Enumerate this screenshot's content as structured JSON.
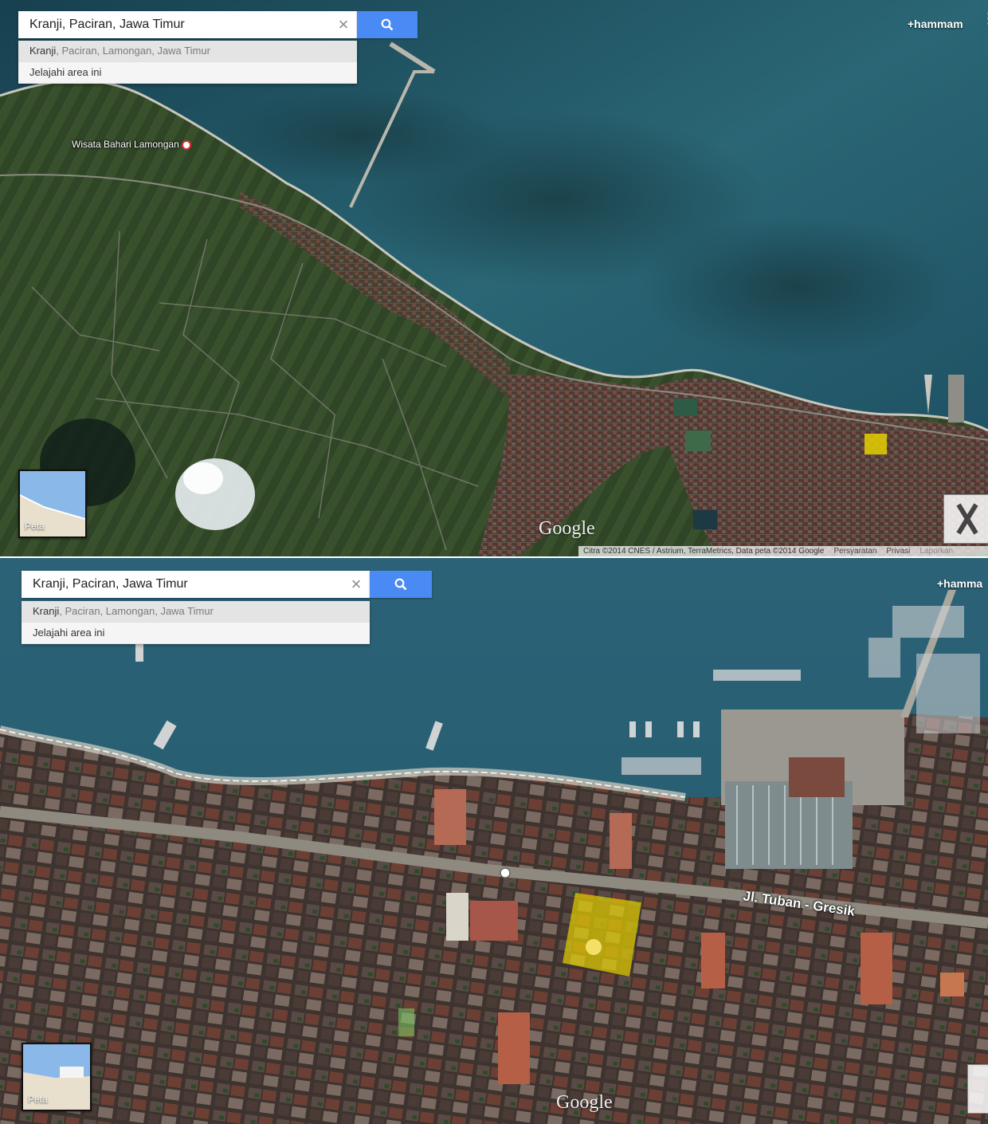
{
  "top_panel": {
    "search": {
      "value": "Kranji, Paciran, Jawa Timur",
      "clear_glyph": "×",
      "button_icon": "search-icon"
    },
    "suggestions": [
      {
        "bold": "Kranji",
        "rest": ", Paciran, Lamongan, Jawa Timur"
      },
      {
        "bold": "",
        "rest": "Jelajahi area ini"
      }
    ],
    "user_link": "+hammam",
    "thumbnail_label": "Peta",
    "poi_label": "Wisata Bahari Lamongan",
    "logo": "Google",
    "attribution": {
      "text": "Citra ©2014 CNES / Astrium, TerraMetrics, Data peta ©2014 Google",
      "terms": "Persyaratan",
      "privacy": "Privasi",
      "report": "Laporkan"
    }
  },
  "bottom_panel": {
    "search": {
      "value": "Kranji, Paciran, Jawa Timur",
      "clear_glyph": "×",
      "button_icon": "search-icon"
    },
    "suggestions": [
      {
        "bold": "Kranji",
        "rest": ", Paciran, Lamongan, Jawa Timur"
      },
      {
        "bold": "",
        "rest": "Jelajahi area ini"
      }
    ],
    "user_link": "+hamma",
    "thumbnail_label": "Peta",
    "street_label": "Jl. Tuban - Gresik",
    "logo": "Google"
  },
  "colors": {
    "sea_deep": "#1f4a5c",
    "sea_shallow": "#3c7f89",
    "land": "#3a4a2c",
    "town": "#5a3f38",
    "highlight": "#e6d000",
    "search_blue": "#4a8af4"
  }
}
